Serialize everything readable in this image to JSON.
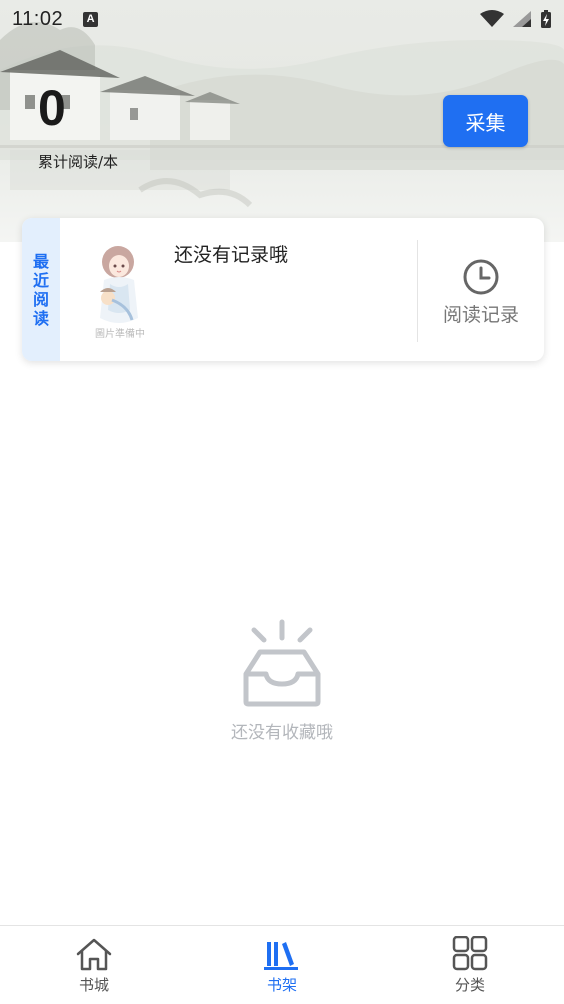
{
  "status_bar": {
    "time": "11:02",
    "a_badge": "A"
  },
  "header": {
    "read_count": "0",
    "read_count_label": "累计阅读/本",
    "collect_button": "采集"
  },
  "recent": {
    "tab_label": "最近阅读",
    "cover_caption": "圖片準備中",
    "empty_title": "还没有记录哦",
    "history_label": "阅读记录"
  },
  "shelf": {
    "empty_text": "还没有收藏哦"
  },
  "bottom_nav": {
    "items": [
      {
        "label": "书城",
        "icon": "home-icon"
      },
      {
        "label": "书架",
        "icon": "bookshelf-icon"
      },
      {
        "label": "分类",
        "icon": "grid-icon"
      }
    ],
    "active_index": 1
  },
  "colors": {
    "accent": "#1f6ff2",
    "tab_bg": "#e3effd",
    "muted": "#b3b6bb"
  }
}
